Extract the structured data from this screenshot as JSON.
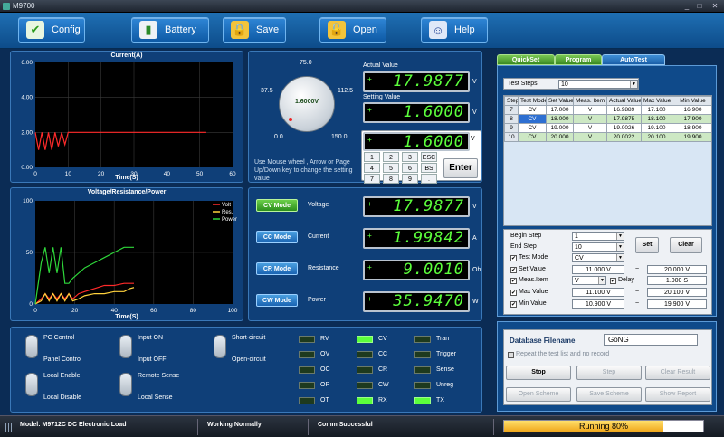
{
  "window": {
    "title": "M9700"
  },
  "toolbar": {
    "buttons": [
      {
        "label": "Config",
        "icon": "checklist-icon"
      },
      {
        "label": "Battery",
        "icon": "battery-icon"
      },
      {
        "label": "Save",
        "icon": "lock-icon"
      },
      {
        "label": "Open",
        "icon": "unlock-icon"
      },
      {
        "label": "Help",
        "icon": "help-person-icon"
      }
    ]
  },
  "current_chart": {
    "title": "Current(A)",
    "xlabel": "Time(S)"
  },
  "vrp_chart": {
    "title": "Voltage/Resistance/Power",
    "xlabel": "Time(S)"
  },
  "chart_data": [
    {
      "type": "line",
      "title": "Current(A)",
      "xlabel": "Time(S)",
      "ylabel": "",
      "ylim": [
        0,
        6
      ],
      "xlim": [
        0,
        60
      ],
      "yticks": [
        "6.00",
        "4.00",
        "2.00",
        "0.00"
      ],
      "xticks": [
        "0",
        "10",
        "20",
        "30",
        "40",
        "50",
        "60"
      ],
      "grid": true,
      "series": [
        {
          "color": "#ff2a2a",
          "x": [
            0,
            1,
            2,
            3,
            4,
            5,
            6,
            7,
            8,
            9,
            10,
            11,
            12,
            14,
            16,
            18,
            20,
            22,
            24,
            26,
            28,
            30,
            32,
            34,
            36,
            38,
            40,
            42,
            44,
            46,
            48,
            50,
            52
          ],
          "y": [
            2.0,
            1.0,
            2.0,
            1.0,
            2.0,
            1.0,
            2.0,
            1.2,
            2.0,
            1.3,
            2.0,
            2.0,
            2.0,
            2.0,
            2.0,
            2.0,
            2.0,
            2.0,
            2.0,
            2.0,
            2.0,
            2.0,
            2.0,
            2.0,
            2.0,
            2.0,
            2.0,
            2.0,
            2.0,
            2.0,
            2.0,
            2.0,
            2.0
          ]
        }
      ]
    },
    {
      "type": "line",
      "title": "Voltage/Resistance/Power",
      "xlabel": "Time(S)",
      "ylim": [
        0,
        100
      ],
      "xlim": [
        0,
        100
      ],
      "yticks": [
        "100",
        "50",
        "0"
      ],
      "xticks": [
        "0",
        "20",
        "40",
        "60",
        "80",
        "100"
      ],
      "grid": true,
      "legend_position": "top-right",
      "series": [
        {
          "name": "Volt",
          "color": "#ff2a2a",
          "x": [
            0,
            3,
            5,
            7,
            9,
            11,
            13,
            15,
            17,
            19,
            22,
            25,
            30,
            35,
            40,
            45,
            48,
            50
          ],
          "y": [
            0,
            5,
            10,
            5,
            10,
            5,
            10,
            5,
            10,
            5,
            10,
            12,
            15,
            18,
            18,
            20,
            20,
            20
          ]
        },
        {
          "name": "Res.",
          "color": "#ffd23c",
          "x": [
            0,
            3,
            5,
            7,
            9,
            11,
            13,
            15,
            17,
            19,
            22,
            25,
            30,
            35,
            40,
            45,
            48,
            50
          ],
          "y": [
            0,
            3,
            10,
            3,
            10,
            3,
            10,
            3,
            10,
            3,
            5,
            8,
            10,
            10,
            12,
            12,
            15,
            16
          ]
        },
        {
          "name": "Power",
          "color": "#2ed63a",
          "x": [
            0,
            3,
            5,
            7,
            9,
            11,
            13,
            15,
            17,
            19,
            22,
            25,
            30,
            35,
            40,
            45,
            48,
            50
          ],
          "y": [
            0,
            40,
            55,
            30,
            55,
            30,
            55,
            20,
            20,
            25,
            30,
            35,
            40,
            45,
            50,
            55,
            55,
            55
          ]
        }
      ]
    }
  ],
  "knob": {
    "value": "1.6000V",
    "labels": [
      "37.5",
      "75.0",
      "112.5",
      "0.0",
      "150.0"
    ]
  },
  "meter": {
    "actual_label": "Actual Value",
    "actual": "17.9877",
    "setting_label": "Setting Value",
    "setting": "1.6000",
    "input": "1.6000",
    "unit": "V",
    "hint": "Use Mouse wheel , Arrow or Page Up/Down key to change the setting value"
  },
  "keypad": {
    "keys": [
      "1",
      "2",
      "3",
      "ESC",
      "4",
      "5",
      "6",
      "BS",
      "7",
      "8",
      "9",
      "."
    ],
    "enter": "Enter"
  },
  "modes": [
    {
      "label": "CV Mode",
      "name": "Voltage",
      "value": "17.9877",
      "unit": "V",
      "active": true
    },
    {
      "label": "CC Mode",
      "name": "Current",
      "value": "1.99842",
      "unit": "A",
      "active": false
    },
    {
      "label": "CR Mode",
      "name": "Resistance",
      "value": "9.0010",
      "unit": "Oh",
      "active": false
    },
    {
      "label": "CW Mode",
      "name": "Power",
      "value": "35.9470",
      "unit": "W",
      "active": false
    }
  ],
  "switches": [
    {
      "top": "PC Control",
      "bottom": "Panel Control"
    },
    {
      "top": "Input ON",
      "bottom": "Input OFF"
    },
    {
      "top": "Short-circuit",
      "bottom": "Open-circuit"
    },
    {
      "top": "Local Enable",
      "bottom": "Local Disable"
    },
    {
      "top": "Remote Sense",
      "bottom": "Local Sense"
    }
  ],
  "leds": [
    {
      "label": "RV",
      "on": false
    },
    {
      "label": "CV",
      "on": true
    },
    {
      "label": "Tran",
      "on": false
    },
    {
      "label": "OV",
      "on": false
    },
    {
      "label": "CC",
      "on": false
    },
    {
      "label": "Trigger",
      "on": false
    },
    {
      "label": "OC",
      "on": false
    },
    {
      "label": "CR",
      "on": false
    },
    {
      "label": "Sense",
      "on": false
    },
    {
      "label": "OP",
      "on": false
    },
    {
      "label": "CW",
      "on": false
    },
    {
      "label": "Unreg",
      "on": false
    },
    {
      "label": "OT",
      "on": false
    },
    {
      "label": "RX",
      "on": true
    },
    {
      "label": "TX",
      "on": true
    }
  ],
  "tabs": [
    "QuickSet",
    "Program",
    "AutoTest"
  ],
  "autotest": {
    "test_steps_label": "Test Steps",
    "test_steps": "10",
    "columns": [
      "Step",
      "Test Mode",
      "Set Value",
      "Meas. Item",
      "Actual Value",
      "Max Value",
      "Min Value"
    ],
    "rows": [
      [
        "7",
        "CV",
        "17.000",
        "V",
        "16.9889",
        "17.100",
        "16.900"
      ],
      [
        "8",
        "CV",
        "18.000",
        "V",
        "17.9875",
        "18.100",
        "17.900"
      ],
      [
        "9",
        "CV",
        "19.000",
        "V",
        "19.0026",
        "19.100",
        "18.900"
      ],
      [
        "10",
        "CV",
        "20.000",
        "V",
        "20.0022",
        "20.100",
        "19.900"
      ]
    ],
    "begin_step_label": "Begin Step",
    "begin_step": "1",
    "end_step_label": "End Step",
    "end_step": "10",
    "test_mode_label": "Test Mode",
    "test_mode": "CV",
    "set_value_label": "Set Value",
    "set_value_min": "11.000 V",
    "set_value_max": "20.000 V",
    "meas_item_label": "Meas.Item",
    "meas_item": "V",
    "delay_label": "Delay",
    "delay": "1.000 S",
    "max_value_label": "Max Value",
    "max_value_min": "11.100 V",
    "max_value_max": "20.100 V",
    "min_value_label": "Min Value",
    "min_value_min": "10.900 V",
    "min_value_max": "19.900 V",
    "tilde": "~",
    "set_btn": "Set",
    "clear_btn": "Clear"
  },
  "database": {
    "label": "Database Filename",
    "filename": "GoNG",
    "repeat_label": "Repeat the test list and no record",
    "buttons": [
      "Stop",
      "Step",
      "Clear Result",
      "Open Scheme",
      "Save Scheme",
      "Show Report"
    ]
  },
  "status": {
    "model": "Model: M9712C DC Electronic Load",
    "state": "Working Normally",
    "comm": "Comm Successful",
    "progress_label": "Running  80%",
    "progress": 0.8
  }
}
